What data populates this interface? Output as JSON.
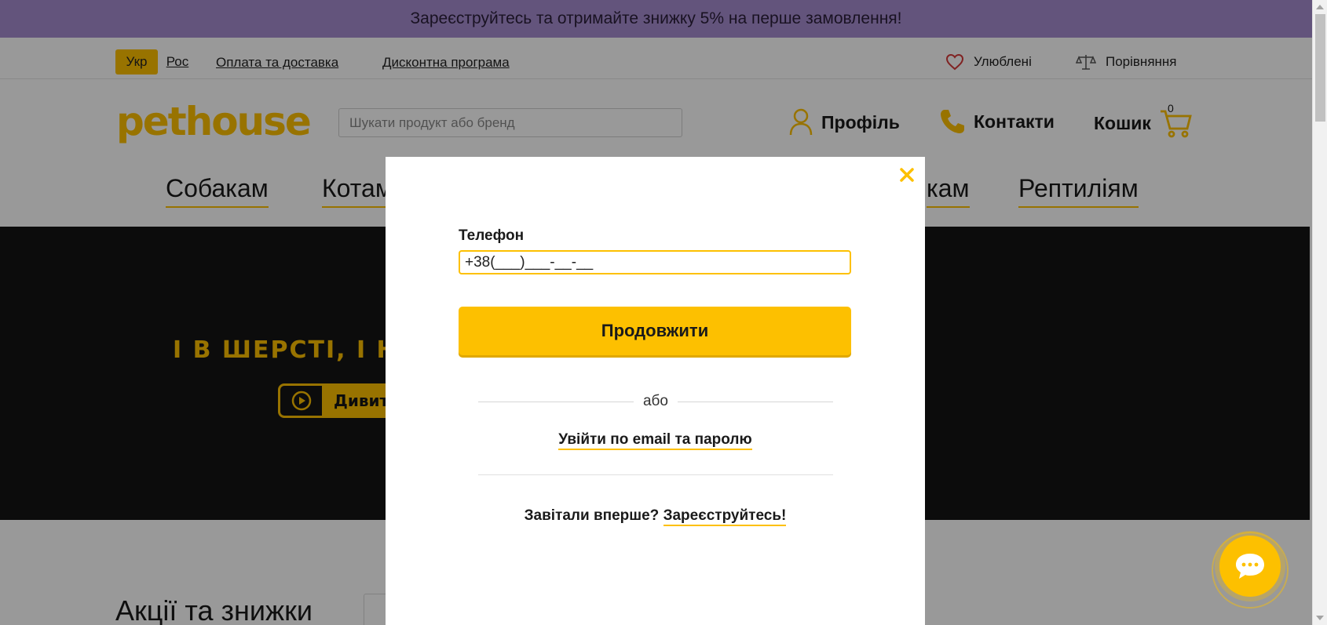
{
  "promo": {
    "text": "Зареєструйтесь та отримайте знижку 5% на перше замовлення!"
  },
  "utility": {
    "lang_active": "Укр",
    "lang_alt": "Рос",
    "payment_link": "Оплата та доставка",
    "discount_link": "Дисконтна програма",
    "favorites": "Улюблені",
    "compare": "Порівняння"
  },
  "header": {
    "logo": "pethouse",
    "search_placeholder": "Шукати продукт або бренд",
    "profile": "Профіль",
    "contacts": "Контакти",
    "cart": "Кошик",
    "cart_count": "0"
  },
  "nav": {
    "dogs": "Собакам",
    "cats": "Котам",
    "partial": "кам",
    "reptiles": "Рептиліям"
  },
  "hero": {
    "headline": "І В ШЕРСТІ, І Н",
    "watch_button": "Дивит"
  },
  "section": {
    "title": "Акції та знижки"
  },
  "modal": {
    "phone_label": "Телефон",
    "phone_value": "+38(___)___-__-__",
    "continue_button": "Продовжити",
    "or_text": "або",
    "email_login_link": "Увійти по email та паролю",
    "first_visit_text": "Завітали вперше?",
    "register_link": "Зареєструйтесь!"
  },
  "colors": {
    "accent": "#fdc000",
    "promo_bg": "#a58ccf"
  },
  "icons": {
    "favorites": "heart-icon",
    "compare": "scales-icon",
    "profile": "user-icon",
    "contacts": "phone-icon",
    "cart": "cart-icon",
    "close": "close-icon",
    "chat": "chat-icon",
    "play": "play-icon"
  }
}
